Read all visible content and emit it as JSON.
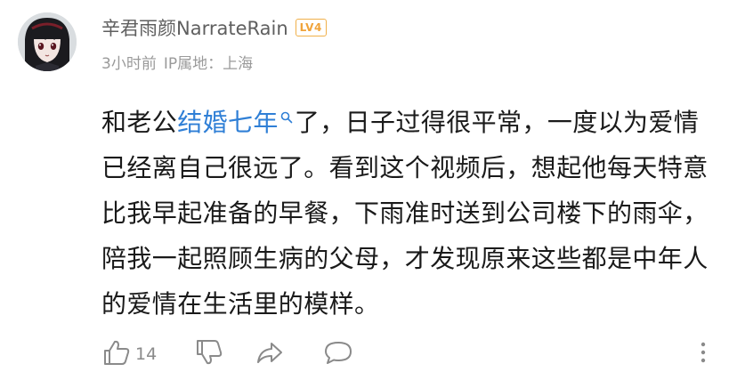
{
  "comment": {
    "author": {
      "name": "辛君雨颜NarrateRain",
      "level": "LV4",
      "avatar_icon": "anime-avatar-icon"
    },
    "meta": {
      "time": "3小时前",
      "location": "IP属地：上海"
    },
    "body": {
      "prefix": "和老公",
      "link_text": "结婚七年",
      "suffix": "了，日子过得很平常，一度以为爱情已经离自己很远了。看到这个视频后，想起他每天特意比我早起准备的早餐，下雨准时送到公司楼下的雨伞，陪我一起照顾生病的父母，才发现原来这些都是中年人的爱情在生活里的模样。"
    },
    "actions": {
      "like_count": "14",
      "like_icon": "thumbs-up-icon",
      "dislike_icon": "thumbs-down-icon",
      "share_icon": "share-icon",
      "reply_icon": "comment-bubble-icon",
      "more_icon": "vertical-dots-icon"
    }
  },
  "colors": {
    "link": "#2f7fd6",
    "badge": "#f0b04a",
    "meta": "#9a9a9a",
    "text": "#1a1a1a"
  }
}
